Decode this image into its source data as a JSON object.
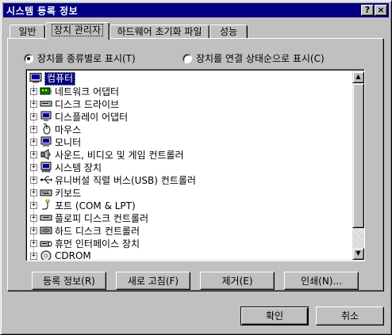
{
  "window": {
    "title": "시스템 등록 정보",
    "help_glyph": "?",
    "close_glyph": "×"
  },
  "tabs": [
    {
      "label": "일반",
      "active": false
    },
    {
      "label": "장치 관리자",
      "active": true
    },
    {
      "label": "하드웨어 초기화 파일",
      "active": false
    },
    {
      "label": "성능",
      "active": false
    }
  ],
  "view_options": {
    "by_type": {
      "label": "장치를 종류별로 표시(T)",
      "checked": true
    },
    "by_connection": {
      "label": "장치를 연결 상태순으로 표시(C)",
      "checked": false
    }
  },
  "tree": {
    "root": {
      "label": "컴퓨터",
      "icon": "computer-icon"
    },
    "items": [
      {
        "label": "네트워크 어댑터",
        "icon": "network-adapter-icon",
        "expander": "+"
      },
      {
        "label": "디스크 드라이브",
        "icon": "disk-drive-icon",
        "expander": "+"
      },
      {
        "label": "디스플레이 어댑터",
        "icon": "display-adapter-icon",
        "expander": "+"
      },
      {
        "label": "마우스",
        "icon": "mouse-icon",
        "expander": "+"
      },
      {
        "label": "모니터",
        "icon": "monitor-icon",
        "expander": "+"
      },
      {
        "label": "사운드, 비디오 및 게임 컨트롤러",
        "icon": "sound-icon",
        "expander": "+"
      },
      {
        "label": "시스템 장치",
        "icon": "system-device-icon",
        "expander": "+"
      },
      {
        "label": "유니버설 직렬 버스(USB) 컨트롤러",
        "icon": "usb-icon",
        "expander": "+"
      },
      {
        "label": "키보드",
        "icon": "keyboard-icon",
        "expander": "+"
      },
      {
        "label": "포트 (COM & LPT)",
        "icon": "port-icon",
        "expander": "+"
      },
      {
        "label": "플로피 디스크 컨트롤러",
        "icon": "floppy-controller-icon",
        "expander": "+"
      },
      {
        "label": "하드 디스크 컨트롤러",
        "icon": "hdd-controller-icon",
        "expander": "+"
      },
      {
        "label": "휴먼 인터페이스 장치",
        "icon": "hid-icon",
        "expander": "+"
      },
      {
        "label": "CDROM",
        "icon": "cdrom-icon",
        "expander": "+"
      }
    ]
  },
  "scrollbar": {
    "up_glyph": "▲",
    "down_glyph": "▼"
  },
  "actions": {
    "properties": "등록 정보(R)",
    "refresh": "새로 고침(F)",
    "remove": "제거(E)",
    "print": "인쇄(N)..."
  },
  "footer": {
    "ok": "확인",
    "cancel": "취소"
  },
  "colors": {
    "title_bar": "#000080",
    "face": "#c0c0c0",
    "selection": "#000080"
  }
}
